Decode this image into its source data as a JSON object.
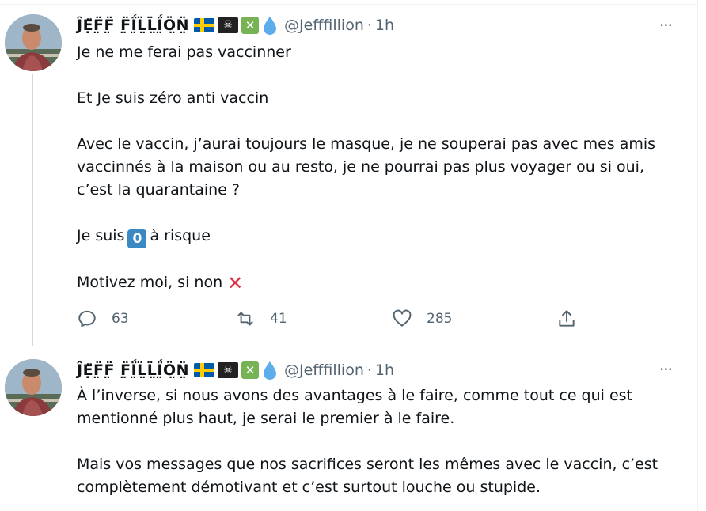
{
  "tweets": [
    {
      "author_name": "ĴẸ̈F̤̈F̤̈ F̤̈Ḯ̤L̤̈L̤̈Ḯ̤Ö̤N̤̈",
      "handle": "@Jefffillion",
      "separator": "·",
      "time": "1h",
      "more": "···",
      "lines": [
        "Je ne me ferai pas vaccinner",
        "",
        "Et Je suis zéro anti vaccin",
        "",
        "Avec le vaccin, j’aurai toujours le masque, je ne souperai pas avec mes amis",
        "vaccinnés à la maison ou au resto, je ne pourrai pas plus voyager ou si oui,",
        "c’est la quarantaine ?",
        "",
        "Je suis",
        "",
        "Motivez moi, si non"
      ],
      "keycap_value": "0",
      "risk_suffix": "à risque",
      "actions": {
        "reply_count": "63",
        "retweet_count": "41",
        "like_count": "285"
      }
    },
    {
      "author_name": "ĴẸ̈F̤̈F̤̈ F̤̈Ḯ̤L̤̈L̤̈Ḯ̤Ö̤N̤̈",
      "handle": "@Jefffillion",
      "separator": "·",
      "time": "1h",
      "more": "···",
      "lines": [
        "À l’inverse, si nous avons des avantages à le faire, comme tout ce qui est",
        "mentionné plus haut, je serai le premier à le faire.",
        "",
        "Mais vos messages que nos sacrifices seront les mêmes avec le vaccin, c’est",
        "complètement démotivant et c’est surtout louche ou stupide."
      ]
    }
  ],
  "icons": {
    "emoji_sequence": [
      "sweden-flag-icon",
      "pirate-flag-icon",
      "cross-mark-button-icon",
      "droplet-icon"
    ],
    "red_x": "cross-mark-icon",
    "reply": "reply-icon",
    "retweet": "retweet-icon",
    "like": "heart-icon",
    "share": "share-icon"
  },
  "colors": {
    "text": "#0f1419",
    "secondary": "#536471",
    "thread_line": "#cfd9de",
    "keycap": "#3b88c3",
    "cross": "#dd2e44"
  }
}
